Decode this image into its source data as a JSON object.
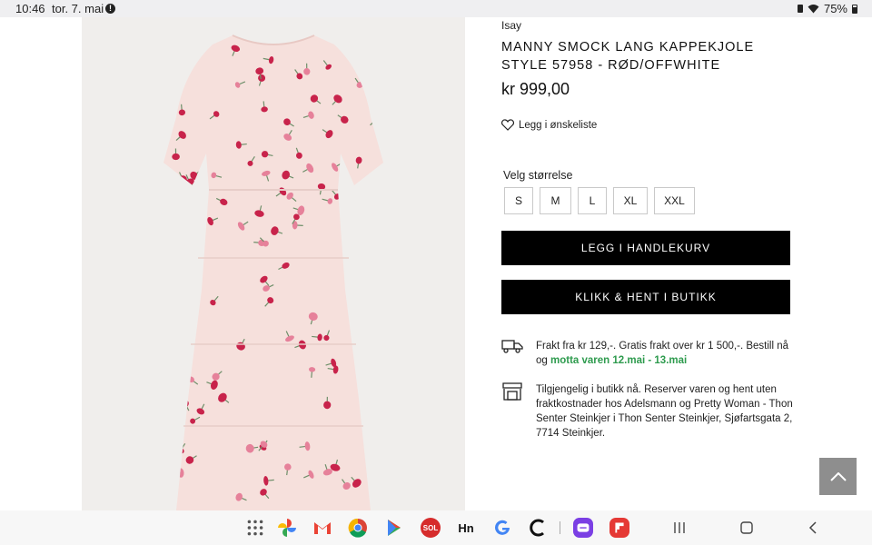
{
  "status_bar": {
    "time": "10:46",
    "date": "tor. 7. mai",
    "battery": "75%"
  },
  "product": {
    "brand": "Isay",
    "title": "MANNY SMOCK LANG KAPPEKJOLE STYLE 57958 - RØD/OFFWHITE",
    "price": "kr 999,00",
    "wishlist_label": "Legg i ønskeliste",
    "size_label": "Velg størrelse",
    "sizes": [
      "S",
      "M",
      "L",
      "XL",
      "XXL"
    ],
    "add_to_cart": "LEGG I HANDLEKURV",
    "click_collect": "KLIKK & HENT I BUTIKK"
  },
  "shipping": {
    "text": "Frakt fra kr 129,-. Gratis frakt over kr 1 500,-. Bestill nå og",
    "delivery": "motta varen 12.mai - 13.mai"
  },
  "store": {
    "text": "Tilgjengelig i butikk nå. Reserver varen og hent uten fraktkostnader hos Adelsmann og Pretty Woman - Thon Senter Steinkjer i Thon Senter Steinkjer, Sjøfartsgata 2, 7714 Steinkjer."
  },
  "dock": {
    "apps": [
      "app-drawer",
      "photos",
      "gmail",
      "chrome",
      "play-store",
      "sol",
      "hn",
      "google",
      "c-app",
      "messages",
      "flipboard"
    ],
    "sol_label": "SOL",
    "hn_label": "Hn"
  },
  "colors": {
    "accent_green": "#2e9b4e",
    "button_black": "#000000",
    "scroll_top_bg": "#8e8e8e"
  }
}
